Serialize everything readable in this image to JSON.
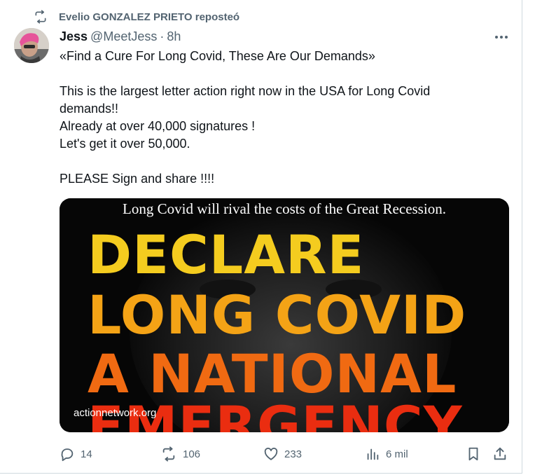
{
  "repost": {
    "icon": "repost-icon",
    "text": "Evelio GONZALEZ PRIETO reposteó"
  },
  "author": {
    "name": "Jess",
    "handle": "@MeetJess",
    "separator": "·",
    "time": "8h",
    "avatar": "avatar"
  },
  "tweet": {
    "line1": "«Find a Cure For Long Covid, These Are Our Demands»",
    "line2": "This is the largest letter action right now in the USA for Long Covid",
    "line3": "demands!!",
    "line4": "Already at over 40,000 signatures !",
    "line5": "Let's get it over 50,000.",
    "line6": "PLEASE Sign and share !!!!"
  },
  "media": {
    "caption": "Long Covid will rival the costs of the Great Recession.",
    "headline": [
      "DECLARE",
      "LONG COVID",
      "A NATIONAL",
      "EMERGENCY"
    ],
    "site": "actionnetwork.org",
    "colors": {
      "yellow": "#f4cc1f",
      "orange": "#f4a316",
      "deep_orange": "#f06a12",
      "red": "#ea2d10"
    }
  },
  "actions": {
    "replies": "14",
    "reposts": "106",
    "likes": "233",
    "views": "6 mil"
  },
  "colors": {
    "secondary_text": "#536471",
    "primary_text": "#0f1419",
    "border": "#cfd9de"
  }
}
